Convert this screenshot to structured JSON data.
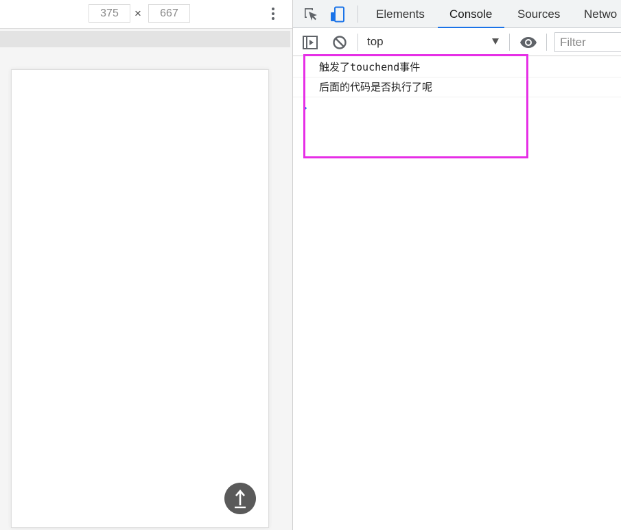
{
  "device_toolbar": {
    "width_value": "375",
    "height_value": "667",
    "times_symbol": "×",
    "more_icon": "kebab-menu-icon"
  },
  "devtools": {
    "tabs": [
      {
        "label": "Elements",
        "active": false
      },
      {
        "label": "Console",
        "active": true
      },
      {
        "label": "Sources",
        "active": false
      },
      {
        "label": "Netwo",
        "active": false
      }
    ],
    "icons": {
      "inspect": "inspect-element-icon",
      "device": "device-toggle-icon",
      "sidebar": "sidebar-toggle-icon",
      "clear": "clear-console-icon",
      "eye": "live-expression-icon"
    },
    "accent_color": "#1a73e8"
  },
  "console_toolbar": {
    "context": "top",
    "filter_placeholder": "Filter"
  },
  "console": {
    "messages": [
      "触发了touchend事件",
      "后面的代码是否执行了呢"
    ],
    "prompt_symbol": "›",
    "highlight_color": "#e62ee6"
  },
  "device_screen": {
    "fab_icon": "arrow-up-icon"
  }
}
